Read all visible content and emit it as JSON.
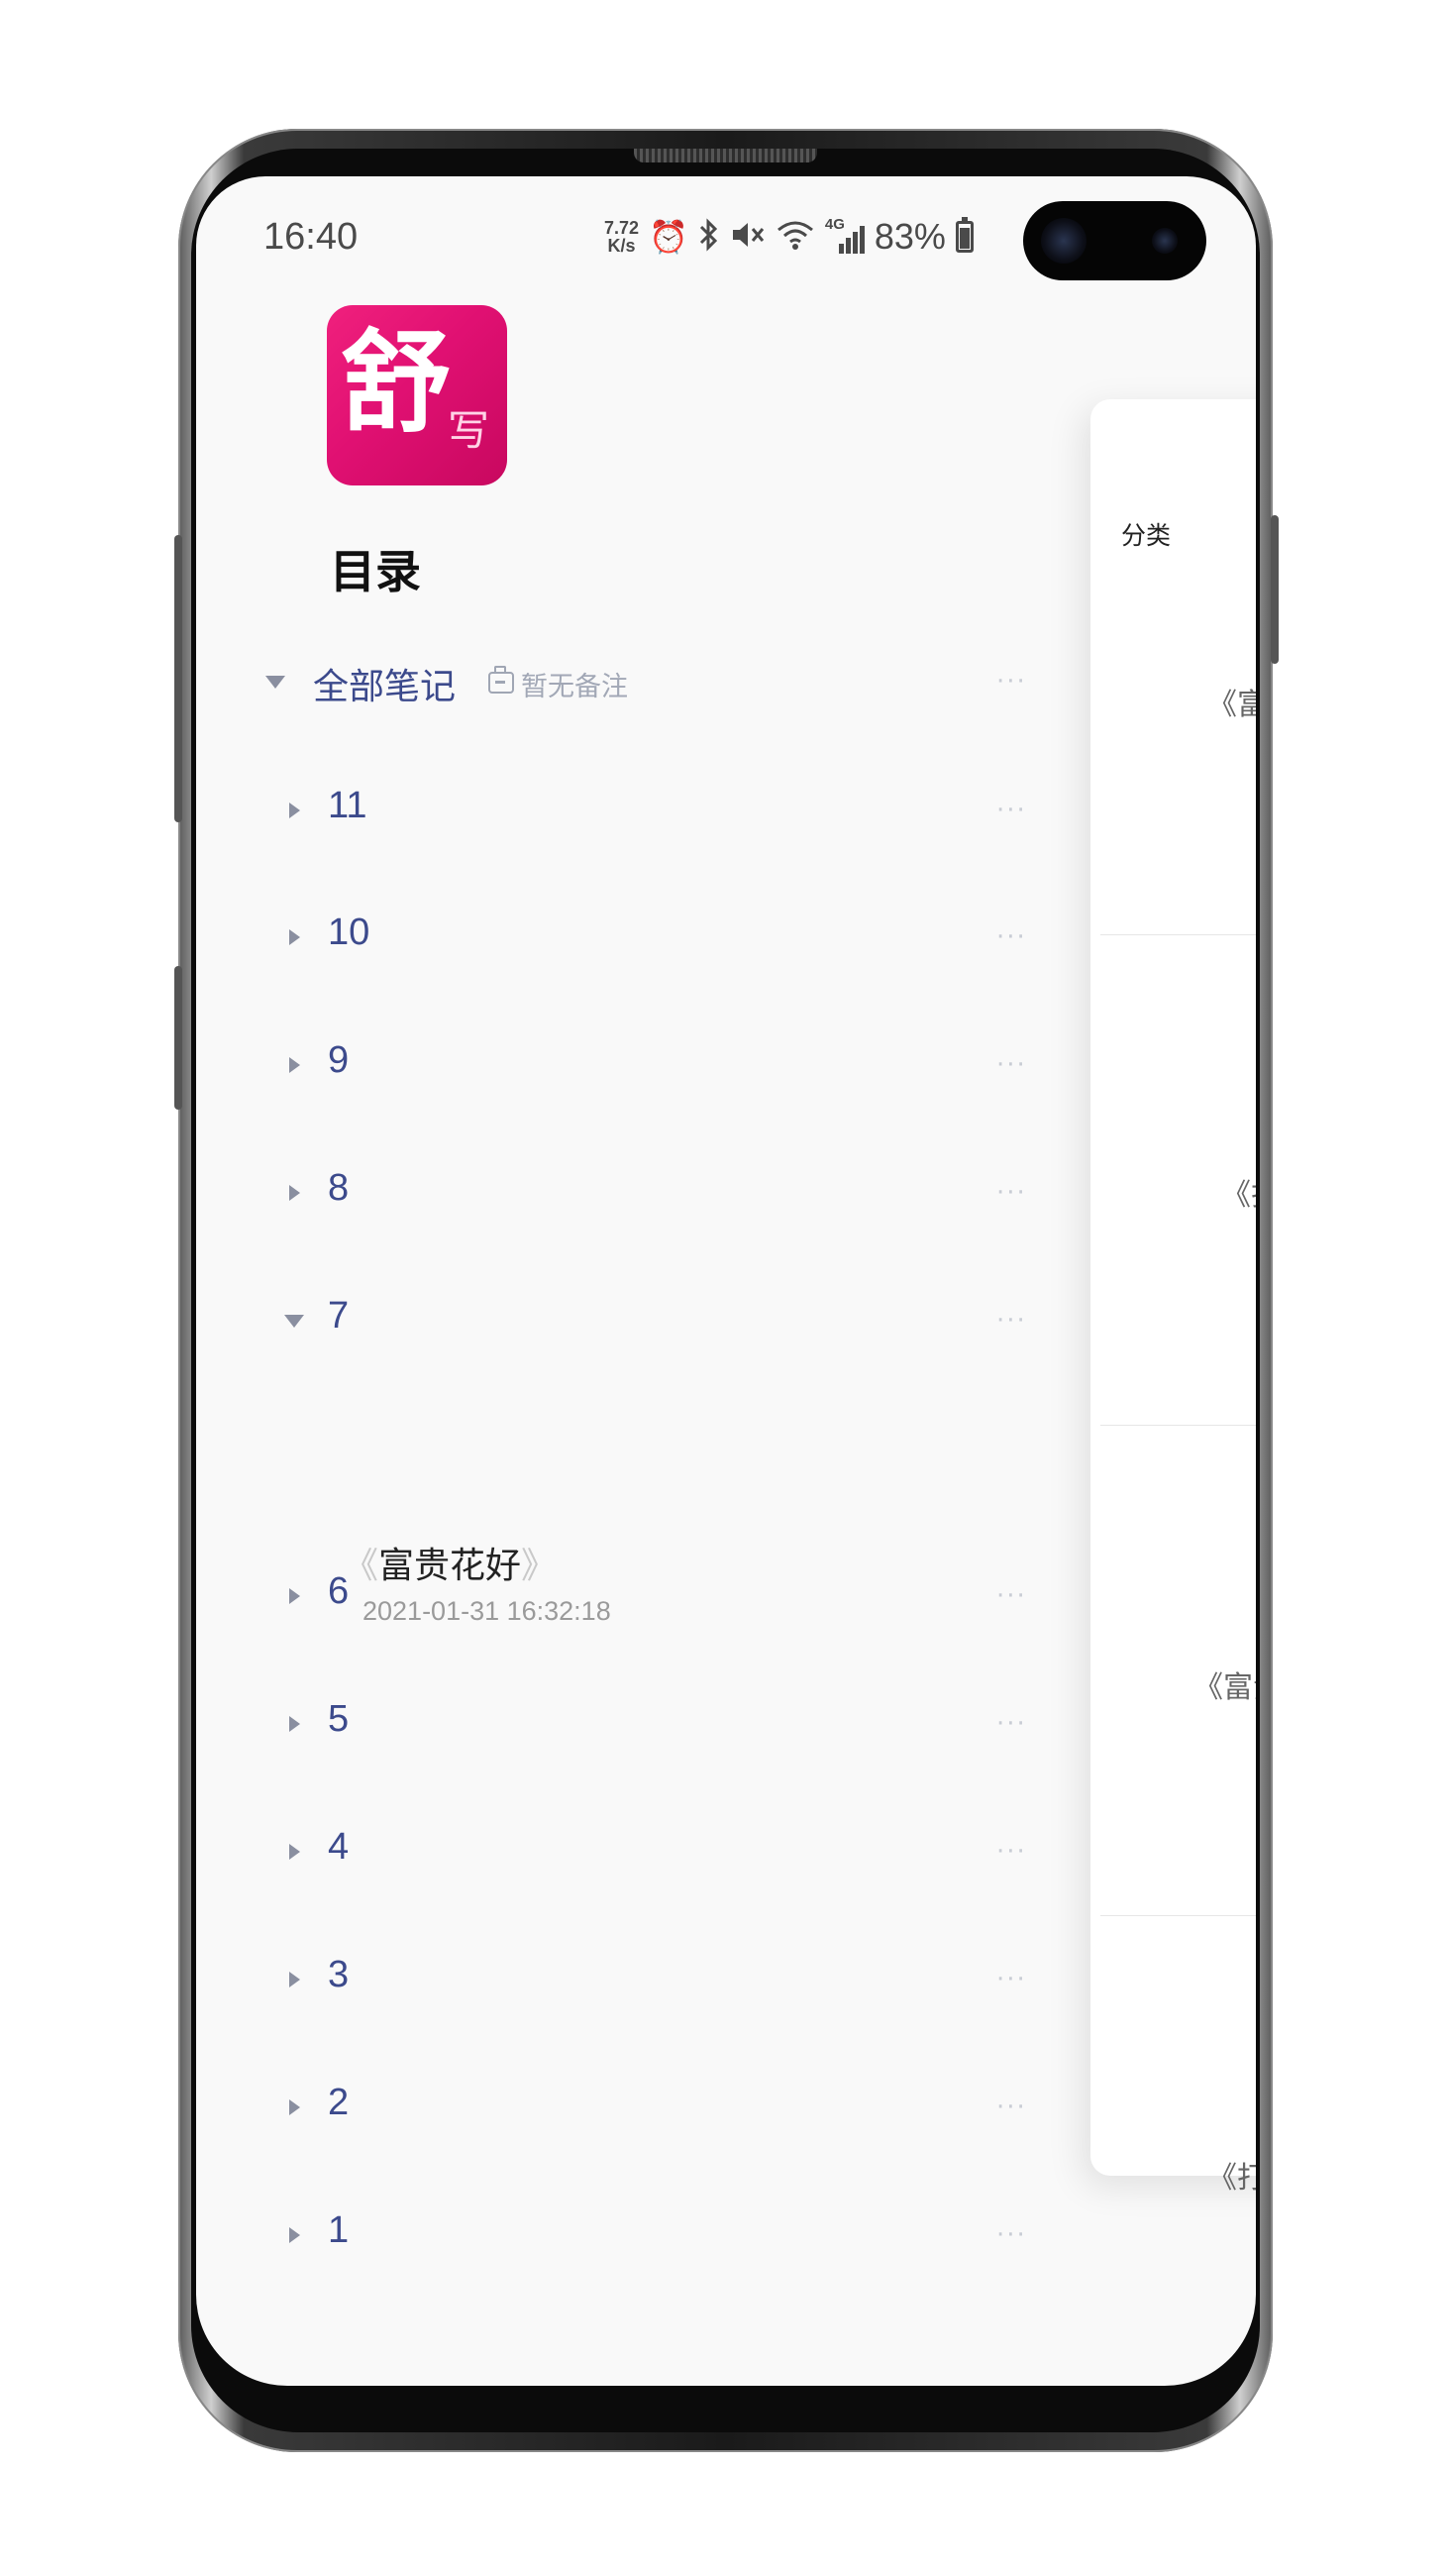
{
  "status_bar": {
    "time": "16:40",
    "net_speed_value": "7.72",
    "net_speed_unit": "K/s",
    "battery_percent": "83%",
    "network_type": "4G",
    "icons": [
      "alarm-icon",
      "bluetooth-icon",
      "mute-icon",
      "wifi-icon",
      "signal-icon",
      "battery-icon"
    ]
  },
  "app": {
    "logo_text": "舒",
    "logo_subtext": "写",
    "accent_color": "#3c4a8c",
    "logo_color": "#e01072"
  },
  "drawer": {
    "title": "目录",
    "all_notes_label": "全部笔记",
    "all_notes_remark": "暂无备注",
    "more_label": "···",
    "categories": [
      {
        "label": "11",
        "expanded": false
      },
      {
        "label": "10",
        "expanded": false
      },
      {
        "label": "9",
        "expanded": false
      },
      {
        "label": "8",
        "expanded": false
      },
      {
        "label": "7",
        "expanded": true
      },
      {
        "label": "6",
        "expanded": false
      },
      {
        "label": "5",
        "expanded": false
      },
      {
        "label": "4",
        "expanded": false
      },
      {
        "label": "3",
        "expanded": false
      },
      {
        "label": "2",
        "expanded": false
      },
      {
        "label": "1",
        "expanded": false
      }
    ],
    "expanded_note": {
      "open_bracket": "《",
      "title": "富贵花好",
      "close_bracket": "》",
      "date": "2021-01-31 16:32:18"
    }
  },
  "main_panel": {
    "header_label": "分类",
    "visible_note_fragments": [
      "《富",
      "《扫",
      "《富贵",
      "《打"
    ]
  }
}
